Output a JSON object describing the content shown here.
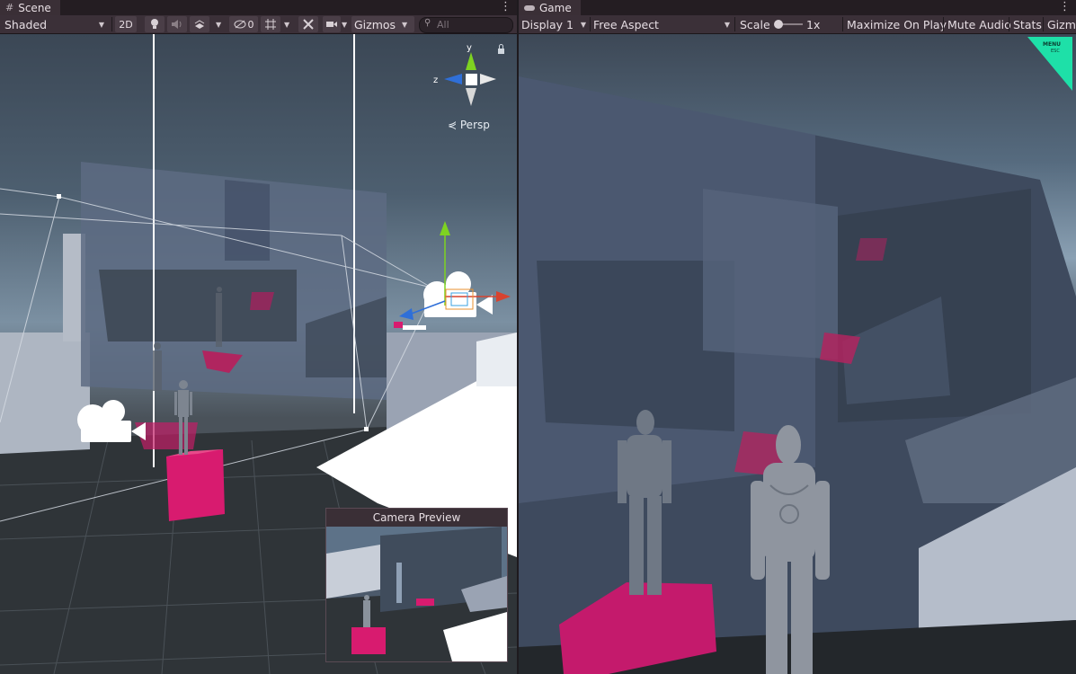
{
  "scene": {
    "tab_title": "Scene",
    "toolbar": {
      "draw_mode": "Shaded",
      "mode_2d": "2D",
      "hidden_count": "0",
      "gizmos": "Gizmos",
      "search_placeholder": "All"
    },
    "orientation": {
      "y": "y",
      "z": "z",
      "persp": "Persp"
    },
    "camera_preview_title": "Camera Preview"
  },
  "game": {
    "tab_title": "Game",
    "toolbar": {
      "display": "Display 1",
      "aspect": "Free Aspect",
      "scale_label": "Scale",
      "scale_value": "1x",
      "maximize": "Maximize On Play",
      "mute": "Mute Audio",
      "stats": "Stats",
      "gizmos": "Gizm"
    },
    "menu_badge": {
      "line1": "MENU",
      "line2": "ESC"
    }
  },
  "colors": {
    "accent_pink": "#d81b6f",
    "gizmo_green": "#7ed321",
    "gizmo_red": "#d8432f",
    "gizmo_blue": "#2f6fd8",
    "menu_badge": "#1ee0a8"
  },
  "icons": [
    "hash-icon",
    "gamepad-icon",
    "kebab-menu-icon",
    "light-bulb-icon",
    "audio-icon",
    "effects-icon",
    "visibility-icon",
    "grid-icon",
    "tools-icon",
    "camera-icon",
    "search-icon",
    "lock-icon"
  ]
}
